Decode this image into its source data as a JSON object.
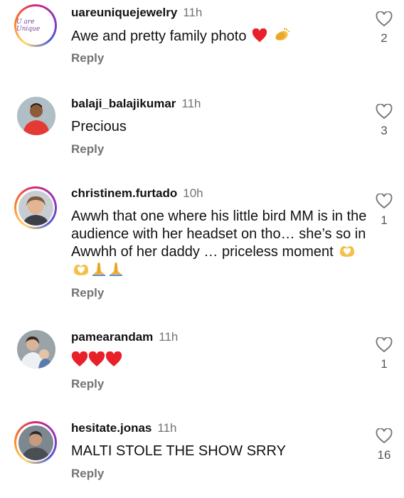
{
  "comments": [
    {
      "username": "uareuniquejewelry",
      "time": "11h",
      "text": "Awe and pretty family photo",
      "reply": "Reply",
      "likes": "2",
      "avatar_text": "U are Unique",
      "emoji": [
        "red-heart",
        "clapping-hands"
      ]
    },
    {
      "username": "balaji_balajikumar",
      "time": "11h",
      "text": "Precious",
      "reply": "Reply",
      "likes": "3",
      "emoji": []
    },
    {
      "username": "christinem.furtado",
      "time": "10h",
      "text": "Awwh that one where his little bird MM is in the audience with her headset on tho… she’s so in Awwhh of her daddy … priceless moment",
      "reply": "Reply",
      "likes": "1",
      "emoji": [
        "heart-hands",
        "heart-hands",
        "folded-hands",
        "folded-hands"
      ]
    },
    {
      "username": "pamearandam",
      "time": "11h",
      "text": "",
      "reply": "Reply",
      "likes": "1",
      "emoji": [
        "red-heart",
        "red-heart",
        "red-heart"
      ]
    },
    {
      "username": "hesitate.jonas",
      "time": "11h",
      "text": "MALTI STOLE THE SHOW SRRY",
      "reply": "Reply",
      "likes": "16",
      "emoji": []
    }
  ],
  "colors": {
    "username": "#111111",
    "meta": "#737373",
    "heart": "#e8202a",
    "story_ring": [
      "#feda75",
      "#fa7e1e",
      "#d62976",
      "#962fbf"
    ]
  }
}
